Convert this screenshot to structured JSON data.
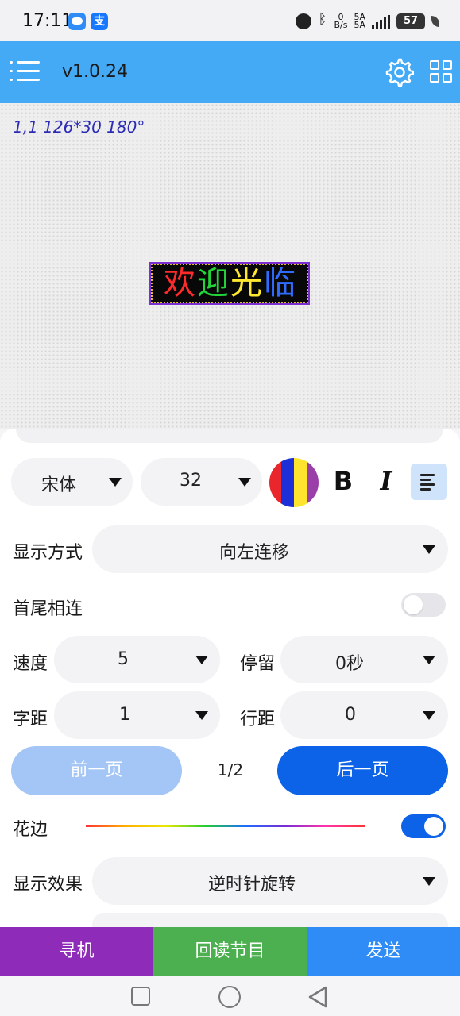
{
  "status_bar": {
    "time": "17:11",
    "app2_glyph": "支",
    "net_speed_top": "0",
    "net_speed_bottom": "B/s",
    "sig1_label": "5A",
    "sig2_label": "5A",
    "battery": "57",
    "icons": [
      "weather-app-icon",
      "alipay-app-icon",
      "alarm-icon",
      "bluetooth-icon",
      "signal-icon",
      "battery-icon",
      "leaf-icon"
    ]
  },
  "appbar": {
    "version": "v1.0.24",
    "background": "#45aaf5"
  },
  "preview": {
    "info": "1,1  126*30  180°",
    "led_chars": [
      {
        "ch": "欢",
        "color": "#ff2a2a"
      },
      {
        "ch": "迎",
        "color": "#22d63a"
      },
      {
        "ch": "光",
        "color": "#ffe830"
      },
      {
        "ch": "临",
        "color": "#2f6bff"
      }
    ]
  },
  "font_row": {
    "font": "宋体",
    "size": "32",
    "color_stripes": [
      "#e8262c",
      "#1d2fd6",
      "#ffe42e",
      "#9b3fa8"
    ],
    "bold": "B",
    "italic": "I"
  },
  "display_mode": {
    "label": "显示方式",
    "value": "向左连移"
  },
  "loop": {
    "label": "首尾相连",
    "on": false
  },
  "speed": {
    "label": "速度",
    "value": "5"
  },
  "stay": {
    "label": "停留",
    "value": "0秒"
  },
  "char_spacing": {
    "label": "字距",
    "value": "1"
  },
  "line_spacing": {
    "label": "行距",
    "value": "0"
  },
  "pager": {
    "prev": "前一页",
    "page": "1/2",
    "next": "后一页"
  },
  "border": {
    "label": "花边",
    "on": true,
    "accent": "#0c63e7"
  },
  "effect": {
    "label": "显示效果",
    "value": "逆时针旋转"
  },
  "actions": [
    {
      "label": "寻机",
      "color": "#8e2bb8"
    },
    {
      "label": "回读节目",
      "color": "#4caf50"
    },
    {
      "label": "发送",
      "color": "#2f8cf6"
    }
  ]
}
